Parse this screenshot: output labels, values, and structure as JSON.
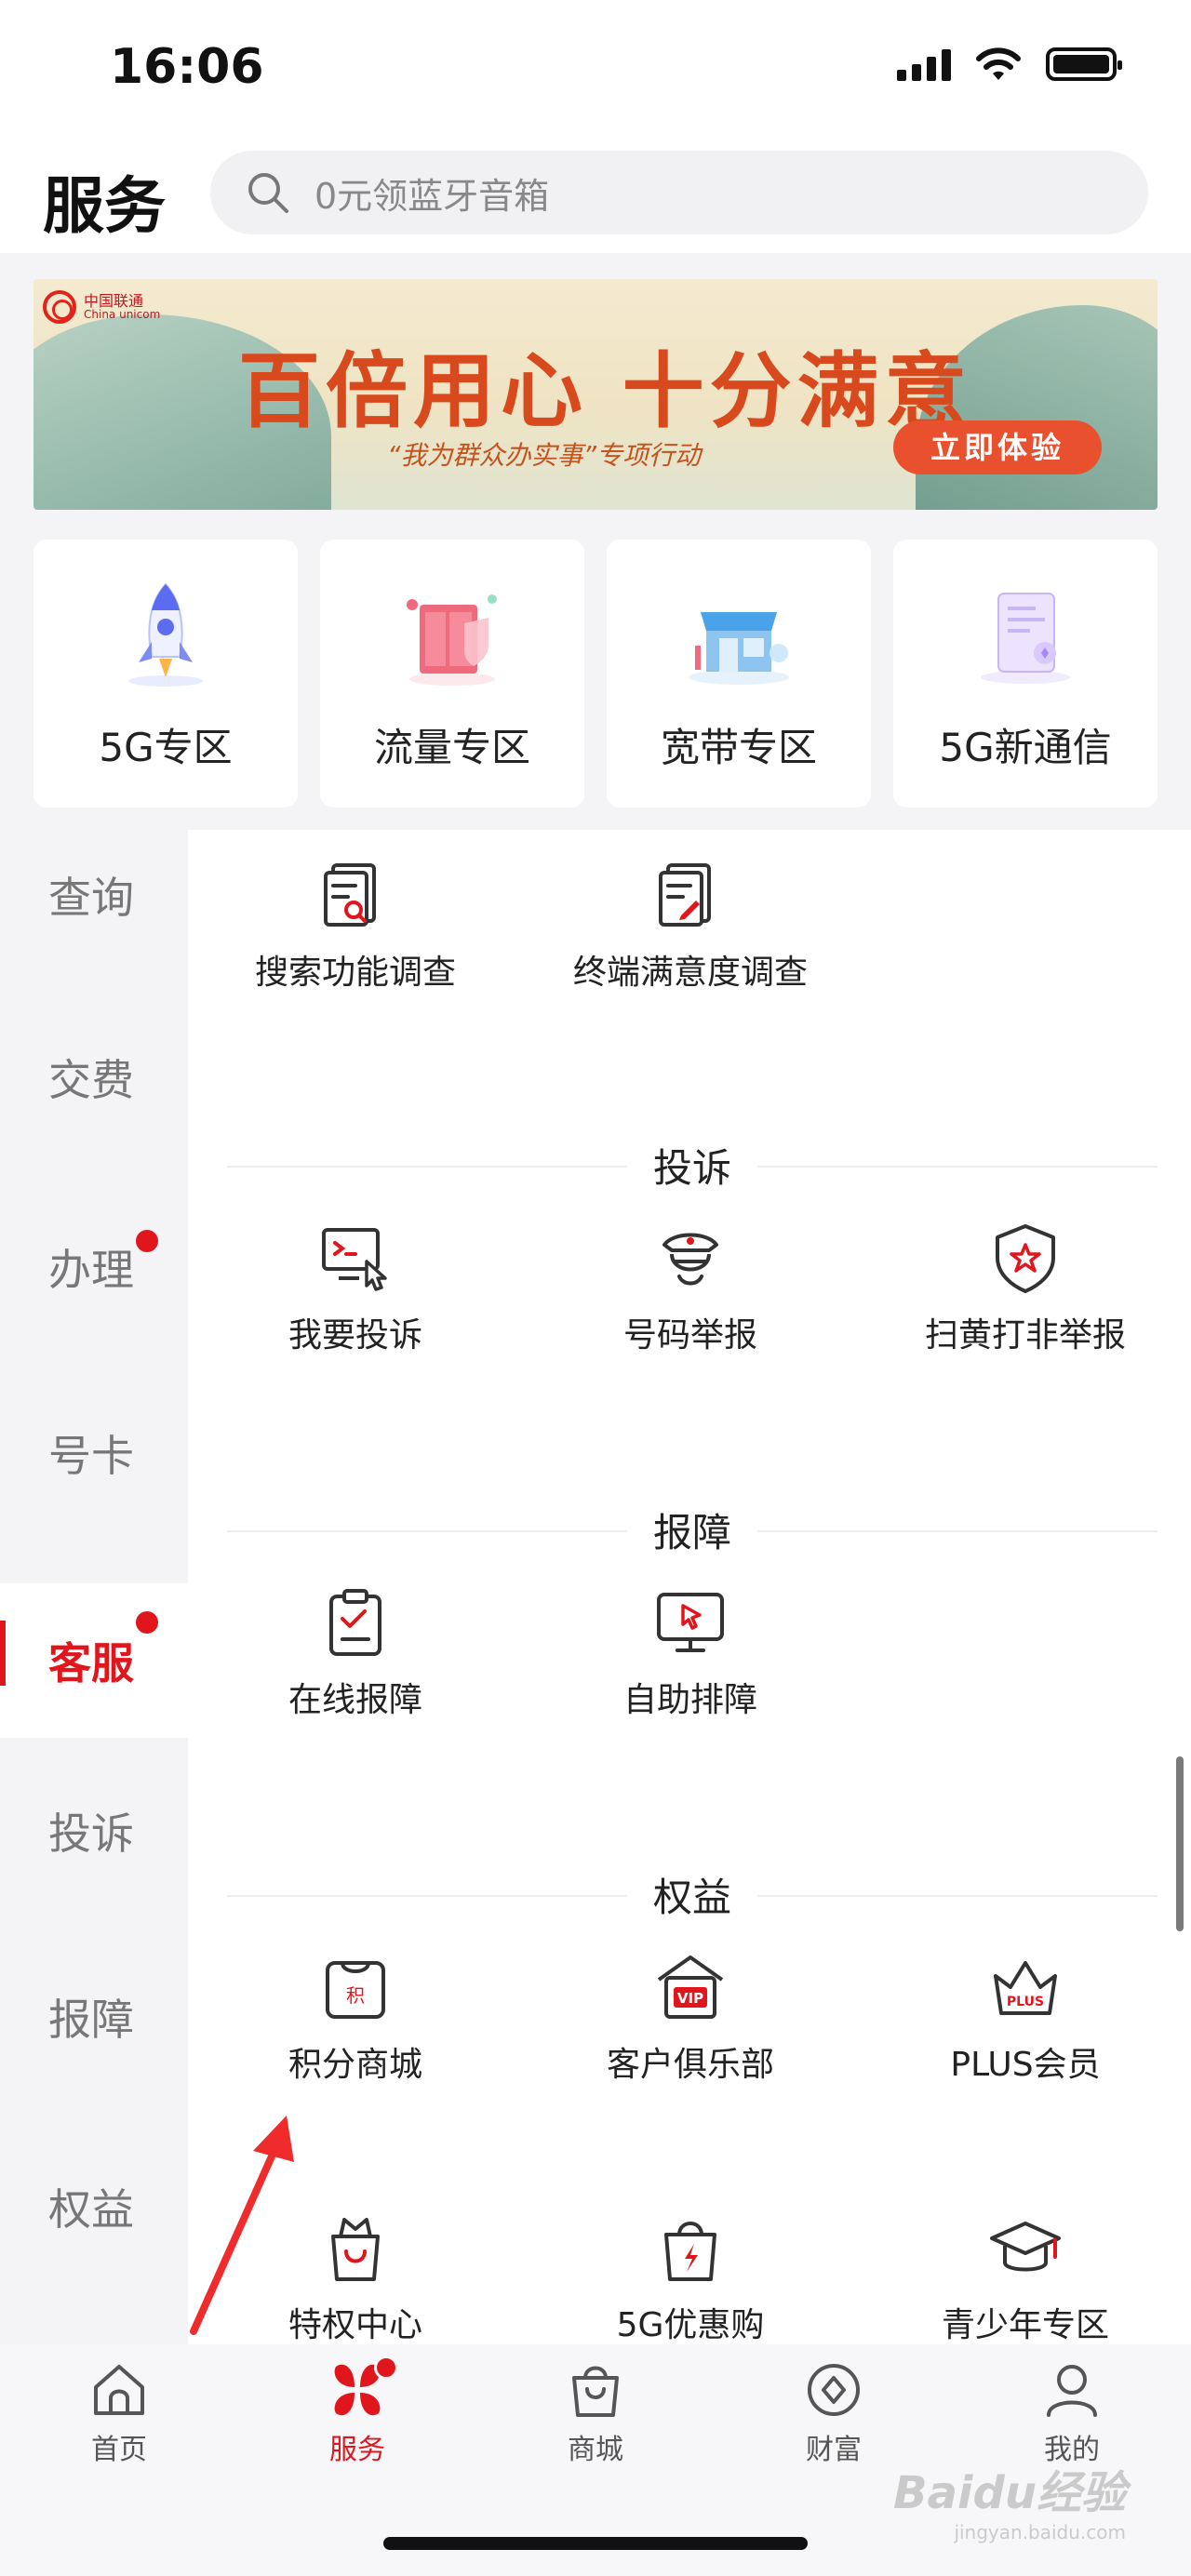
{
  "status_bar": {
    "time": "16:06"
  },
  "header": {
    "title": "服务",
    "search_placeholder": "0元领蓝牙音箱"
  },
  "banner": {
    "brand_cn": "中国联通",
    "brand_en": "China unicom",
    "headline": "百倍用心 十分满意",
    "subline": "“我为群众办实事”专项行动",
    "cta": "立即体验"
  },
  "zones": [
    {
      "label": "5G专区",
      "icon": "rocket-icon"
    },
    {
      "label": "流量专区",
      "icon": "data-traffic-icon"
    },
    {
      "label": "宽带专区",
      "icon": "broadband-store-icon"
    },
    {
      "label": "5G新通信",
      "icon": "new-communication-icon"
    }
  ],
  "sidebar": {
    "items": [
      {
        "label": "查询"
      },
      {
        "label": "交费"
      },
      {
        "label": "办理",
        "badge": true
      },
      {
        "label": "号卡"
      },
      {
        "label": "客服",
        "badge": true,
        "active": true
      },
      {
        "label": "投诉"
      },
      {
        "label": "报障"
      },
      {
        "label": "权益"
      }
    ]
  },
  "content": {
    "survey_items": [
      {
        "label": "搜索功能调查",
        "icon": "search-survey-icon"
      },
      {
        "label": "终端满意度调查",
        "icon": "terminal-survey-icon"
      }
    ],
    "sections": [
      {
        "title": "投诉",
        "items": [
          {
            "label": "我要投诉",
            "icon": "complaint-icon"
          },
          {
            "label": "号码举报",
            "icon": "number-report-icon"
          },
          {
            "label": "扫黄打非举报",
            "icon": "shield-star-icon"
          }
        ]
      },
      {
        "title": "报障",
        "items": [
          {
            "label": "在线报障",
            "icon": "clipboard-check-icon"
          },
          {
            "label": "自助排障",
            "icon": "monitor-cursor-icon"
          }
        ]
      },
      {
        "title": "权益",
        "items": [
          {
            "label": "积分商城",
            "icon": "points-mall-icon"
          },
          {
            "label": "客户俱乐部",
            "icon": "vip-club-icon"
          },
          {
            "label": "PLUS会员",
            "icon": "plus-crown-icon"
          },
          {
            "label": "特权中心",
            "icon": "privilege-bag-icon"
          },
          {
            "label": "5G优惠购",
            "icon": "5g-shopping-icon"
          },
          {
            "label": "青少年专区",
            "icon": "graduation-cap-icon"
          }
        ]
      }
    ],
    "points_mall_glyph": "积",
    "vip_glyph": "VIP",
    "plus_glyph": "PLUS"
  },
  "tabbar": {
    "items": [
      {
        "label": "首页",
        "icon": "home-icon"
      },
      {
        "label": "服务",
        "icon": "service-flower-icon",
        "active": true,
        "badge": true
      },
      {
        "label": "商城",
        "icon": "shopping-bag-icon"
      },
      {
        "label": "财富",
        "icon": "wealth-coin-icon"
      },
      {
        "label": "我的",
        "icon": "profile-icon"
      }
    ]
  },
  "watermark": {
    "text": "Baidu经验",
    "sub": "jingyan.baidu.com"
  },
  "colors": {
    "accent": "#e1161d",
    "sidebar_bg": "#f4f4f6",
    "banner_cta": "#e8502e"
  }
}
